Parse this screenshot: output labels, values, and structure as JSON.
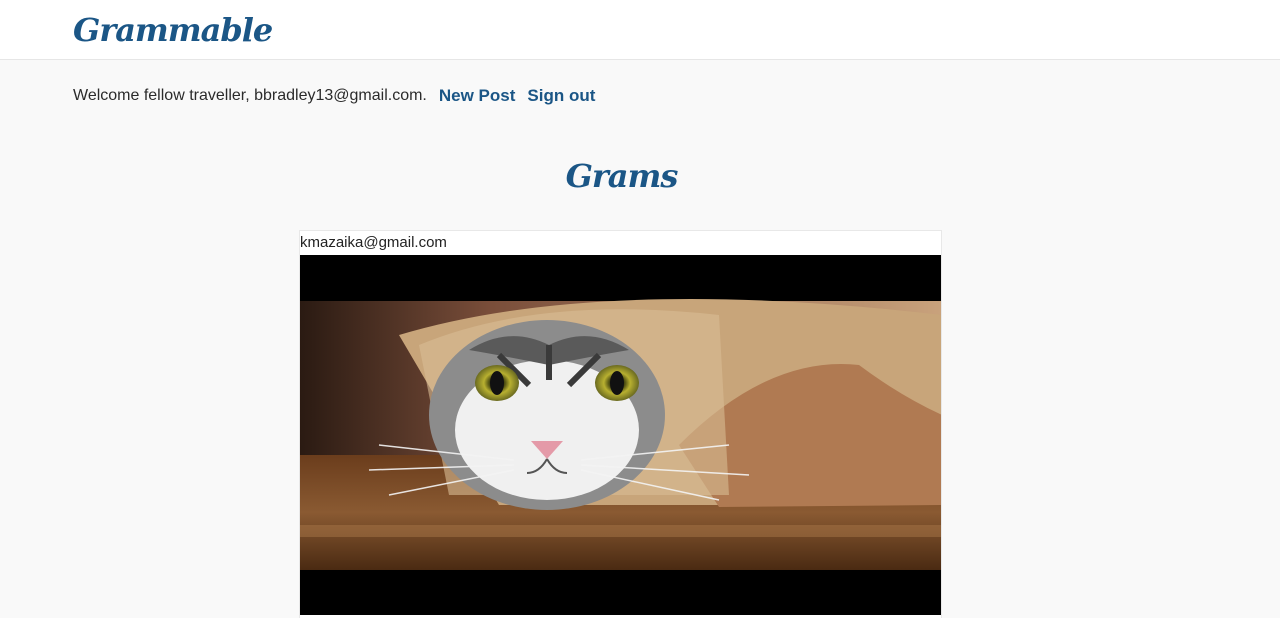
{
  "header": {
    "brand": "Grammable"
  },
  "welcome": {
    "text": "Welcome fellow traveller, bbradley13@gmail.com.",
    "new_post_label": "New Post",
    "sign_out_label": "Sign out"
  },
  "main": {
    "title": "Grams",
    "grams": [
      {
        "author": "kmazaika@gmail.com",
        "image_subject": "cat peeking out of a paper bag on a wooden floor"
      }
    ]
  },
  "colors": {
    "brand": "#1b5686",
    "background": "#f9f9f9"
  }
}
